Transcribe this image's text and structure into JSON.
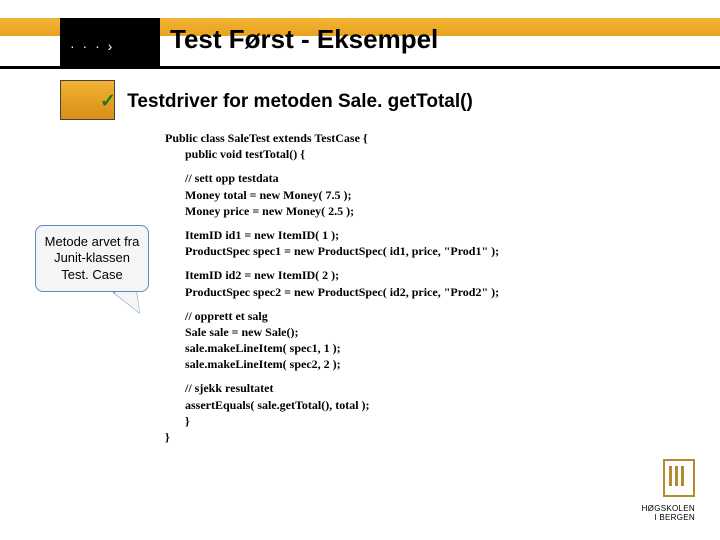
{
  "title": "Test Først - Eksempel",
  "dots": "· · · ›",
  "bullet": {
    "check": "✓",
    "text": "Testdriver for metoden Sale. getTotal()"
  },
  "callout": "Metode arvet fra Junit-klassen Test. Case",
  "code": {
    "l1": "Public class SaleTest extends TestCase {",
    "l2": "public void testTotal() {",
    "l3": "// sett opp testdata",
    "l4": "Money total = new Money( 7.5 );",
    "l5": "Money price = new Money( 2.5 );",
    "l6": "ItemID id1 = new ItemID( 1 );",
    "l7": "ProductSpec spec1 = new ProductSpec( id1, price, \"Prod1\" );",
    "l8": "ItemID id2 = new ItemID( 2 );",
    "l9": "ProductSpec spec2 = new ProductSpec( id2, price, \"Prod2\" );",
    "l10": "// opprett et salg",
    "l11": "Sale sale = new Sale();",
    "l12": "sale.makeLineItem( spec1, 1 );",
    "l13": "sale.makeLineItem( spec2, 2 );",
    "l14": "// sjekk resultatet",
    "l15": "assertEquals( sale.getTotal(), total );",
    "l16": "}",
    "l17": "}"
  },
  "logo": {
    "line1": "HØGSKOLEN",
    "line2": "I BERGEN"
  }
}
